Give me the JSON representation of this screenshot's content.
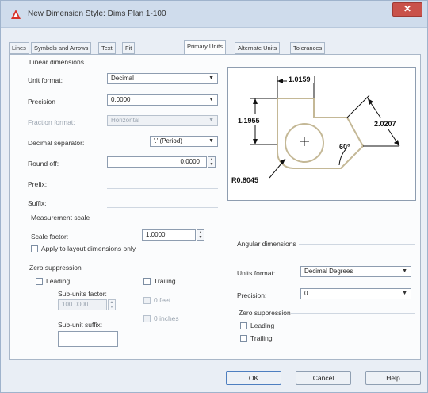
{
  "window": {
    "title": "New Dimension Style: Dims Plan 1-100",
    "close_glyph": "✕"
  },
  "tabs": [
    "Lines",
    "Symbols and Arrows",
    "Text",
    "Fit",
    "Primary Units",
    "Alternate Units",
    "Tolerances"
  ],
  "linear": {
    "group_label": "Linear dimensions",
    "unit_format_label": "Unit format:",
    "unit_format_value": "Decimal",
    "precision_label": "Precision",
    "precision_value": "0.0000",
    "fraction_format_label": "Fraction format:",
    "fraction_format_value": "Horizontal",
    "decimal_sep_label": "Decimal separator:",
    "decimal_sep_value": "'.' (Period)",
    "round_off_label": "Round off:",
    "round_off_value": "0.0000",
    "prefix_label": "Prefix:",
    "suffix_label": "Suffix:"
  },
  "measurement": {
    "group_label": "Measurement scale",
    "scale_label": "Scale factor:",
    "scale_value": "1.0000",
    "layout_only_label": "Apply to layout dimensions only"
  },
  "zero_left": {
    "group_label": "Zero suppression",
    "leading_label": "Leading",
    "trailing_label": "Trailing",
    "subunits_factor_label": "Sub-units factor:",
    "subunits_factor_value": "100.0000",
    "feet_label": "0 feet",
    "inches_label": "0 inches",
    "subunit_suffix_label": "Sub-unit suffix:"
  },
  "angular": {
    "group_label": "Angular dimensions",
    "units_format_label": "Units format:",
    "units_format_value": "Decimal Degrees",
    "precision_label": "Precision:",
    "precision_value": "0",
    "zero_label": "Zero suppression",
    "leading_label": "Leading",
    "trailing_label": "Trailing"
  },
  "preview": {
    "dim_top": "1.0159",
    "dim_left": "1.1955",
    "dim_right": "2.0207",
    "dim_angle": "60°",
    "dim_radius": "R0.8045"
  },
  "buttons": {
    "ok": "OK",
    "cancel": "Cancel",
    "help": "Help"
  },
  "colors": {
    "drawing_outline": "#c4b896",
    "titlebar": "#cfdcec",
    "panel": "#fbfcfd",
    "close": "#c9524a"
  }
}
